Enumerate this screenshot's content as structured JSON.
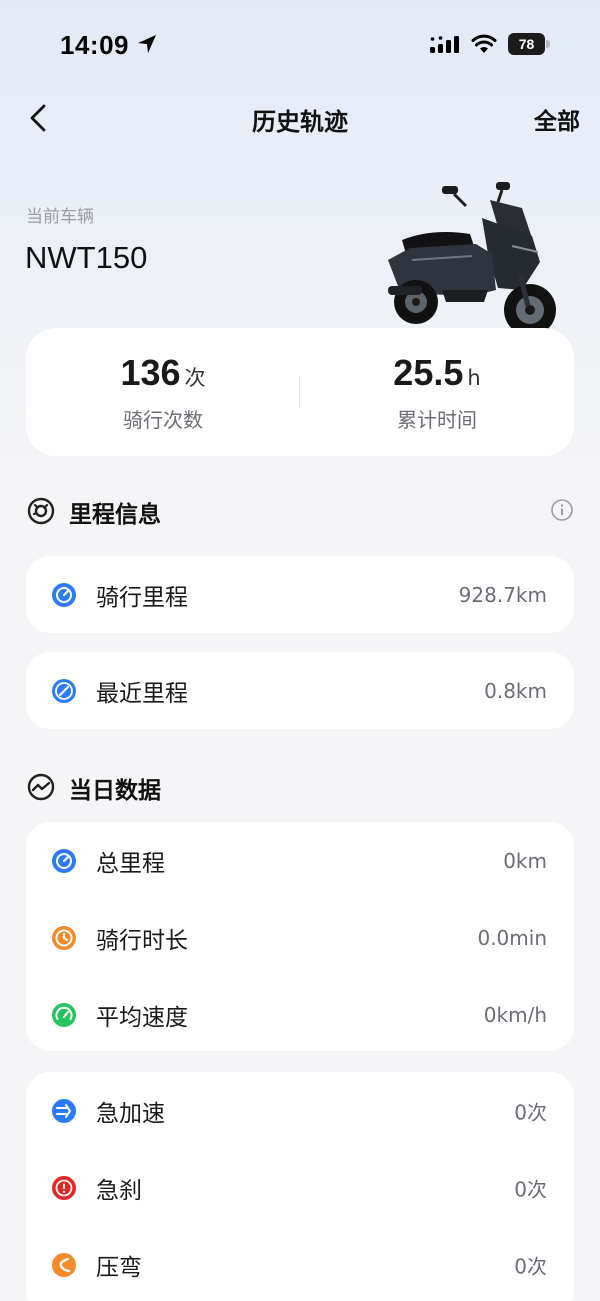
{
  "status_bar": {
    "time": "14:09",
    "battery": "78"
  },
  "nav": {
    "title": "历史轨迹",
    "right_action": "全部"
  },
  "vehicle": {
    "label": "当前车辆",
    "name": "NWT150"
  },
  "stats": {
    "rides": {
      "value": "136",
      "unit": "次",
      "label": "骑行次数"
    },
    "duration": {
      "value": "25.5",
      "unit": "h",
      "label": "累计时间"
    }
  },
  "mileage_section": {
    "title": "里程信息",
    "items": [
      {
        "label": "骑行里程",
        "value": "928.7km",
        "icon": "odometer-icon",
        "color": "#2b7bf6"
      },
      {
        "label": "最近里程",
        "value": "0.8km",
        "icon": "recent-mileage-icon",
        "color": "#2b7bf6"
      }
    ]
  },
  "daily_section": {
    "title": "当日数据",
    "stats": [
      {
        "label": "总里程",
        "value": "0km",
        "icon": "total-mileage-icon",
        "color": "#2b7bf6"
      },
      {
        "label": "骑行时长",
        "value": "0.0min",
        "icon": "clock-icon",
        "color": "#f58a2a"
      },
      {
        "label": "平均速度",
        "value": "0km/h",
        "icon": "speedometer-icon",
        "color": "#22c55e"
      }
    ],
    "events": [
      {
        "label": "急加速",
        "value": "0次",
        "icon": "acceleration-icon",
        "color": "#2b7bf6"
      },
      {
        "label": "急刹",
        "value": "0次",
        "icon": "brake-alert-icon",
        "color": "#e52525"
      },
      {
        "label": "压弯",
        "value": "0次",
        "icon": "cornering-icon",
        "color": "#f58a2a"
      }
    ]
  }
}
